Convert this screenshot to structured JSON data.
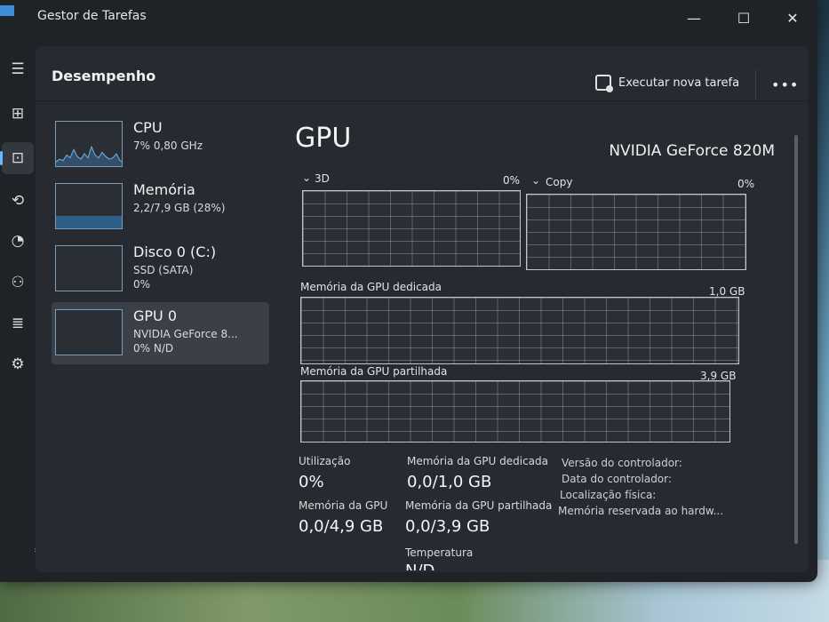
{
  "window": {
    "title": "Gestor de Tarefas",
    "minimize_glyph": "—",
    "maximize_glyph": "☐",
    "close_glyph": "✕"
  },
  "nav": {
    "items": [
      {
        "icon": "hamburger-menu-icon",
        "glyph": "☰"
      },
      {
        "icon": "processes-icon",
        "glyph": "⊞"
      },
      {
        "icon": "performance-icon",
        "glyph": "⊡"
      },
      {
        "icon": "app-history-icon",
        "glyph": "⟲"
      },
      {
        "icon": "startup-apps-icon",
        "glyph": "◔"
      },
      {
        "icon": "users-icon",
        "glyph": "⚇"
      },
      {
        "icon": "details-icon",
        "glyph": "≣"
      },
      {
        "icon": "services-icon",
        "glyph": "⚙"
      }
    ],
    "settings_glyph": "⚙"
  },
  "header": {
    "title": "Desempenho",
    "run_task_label": "Executar nova tarefa",
    "more_glyph": "•••"
  },
  "devices": [
    {
      "name": "CPU",
      "sub1": "7% 0,80 GHz",
      "sub2": ""
    },
    {
      "name": "Memória",
      "sub1": "2,2/7,9 GB (28%)",
      "sub2": "",
      "fill": 0.28
    },
    {
      "name": "Disco 0 (C:)",
      "sub1": "SSD (SATA)",
      "sub2": "0%"
    },
    {
      "name": "GPU 0",
      "sub1": "NVIDIA GeForce 8...",
      "sub2": "0% N/D"
    }
  ],
  "cpu_sparkline": [
    3,
    5,
    4,
    8,
    6,
    12,
    7,
    5,
    9,
    6,
    14,
    8,
    6,
    10,
    7,
    5,
    6,
    9,
    4,
    3
  ],
  "detail": {
    "title": "GPU",
    "model": "NVIDIA GeForce 820M",
    "engine1_label": "3D",
    "engine1_pct": "0%",
    "engine2_label": "Copy",
    "engine2_pct": "0%",
    "chevron": "⌄",
    "dedicated_label": "Memória da GPU dedicada",
    "dedicated_max": "1,0 GB",
    "shared_label": "Memória da GPU partilhada",
    "shared_max": "3,9 GB",
    "stats": {
      "util_label": "Utilização",
      "util_value": "0%",
      "ded_label": "Memória da GPU dedicada",
      "ded_value": "0,0/1,0 GB",
      "gpu_mem_label": "Memória da GPU",
      "gpu_mem_value": "0,0/4,9 GB",
      "shared_label": "Memória da GPU partilhada",
      "shared_value": "0,0/3,9 GB",
      "temp_label": "Temperatura",
      "temp_value": "N/D"
    },
    "info": {
      "driver_version": "Versão do controlador:",
      "driver_date": "Data do controlador:",
      "physical_location": "Localização física:",
      "reserved_memory": "Memória reservada ao hardw..."
    }
  }
}
